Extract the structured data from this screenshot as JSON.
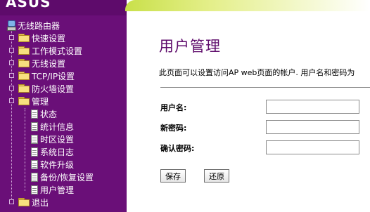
{
  "sidebar": {
    "root": "无线路由器",
    "items": [
      {
        "label": "快速设置"
      },
      {
        "label": "工作模式设置"
      },
      {
        "label": "无线设置"
      },
      {
        "label": "TCP/IP设置"
      },
      {
        "label": "防火墙设置"
      },
      {
        "label": "管理"
      },
      {
        "label": "退出"
      }
    ],
    "admin_children": [
      {
        "label": "状态"
      },
      {
        "label": "统计信息"
      },
      {
        "label": "时区设置"
      },
      {
        "label": "系统日志"
      },
      {
        "label": "软件升级"
      },
      {
        "label": "备份/恢复设置"
      },
      {
        "label": "用户管理"
      }
    ]
  },
  "main": {
    "title": "用户管理",
    "description": "此页面可以设置访问AP web页面的帐户. 用户名和密码为",
    "form": {
      "username_label": "用户名:",
      "new_password_label": "新密码:",
      "confirm_password_label": "确认密码:",
      "username_value": "",
      "new_password_value": "",
      "confirm_password_value": ""
    },
    "buttons": {
      "save": "保存",
      "reset": "还原"
    }
  },
  "colors": {
    "sidebar_bg": "#6a0f78",
    "title_color": "#5e0b6b",
    "banner_accent": "#c9e04a"
  }
}
